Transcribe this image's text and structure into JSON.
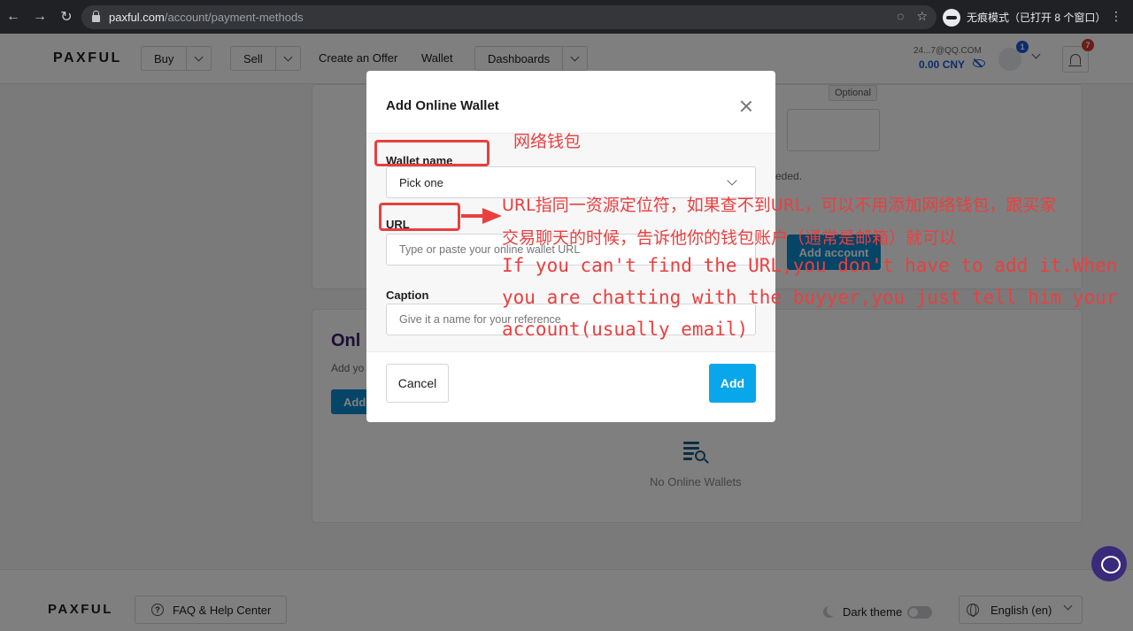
{
  "browser": {
    "url_host": "paxful.com",
    "url_path": "/account/payment-methods",
    "incognito_label": "无痕模式（已打开 8 个窗口）"
  },
  "header": {
    "logo": "PAXFUL",
    "nav": {
      "buy": "Buy",
      "sell": "Sell",
      "create_offer": "Create an Offer",
      "wallet": "Wallet",
      "dashboards": "Dashboards"
    },
    "account_email": "24...7@QQ.COM",
    "balance": "0.00 CNY",
    "notifications_badge": "1",
    "bell_badge": "7"
  },
  "background": {
    "optional_tag": "Optional",
    "needed_text": "eded.",
    "add_account_button": "Add account",
    "online_wallets_heading": "Onl",
    "add_your_text": "Add yo",
    "add_button": "Add",
    "empty_state": "No Online Wallets"
  },
  "modal": {
    "title": "Add Online Wallet",
    "wallet_name_label": "Wallet name",
    "wallet_name_value": "Pick one",
    "url_label": "URL",
    "url_placeholder": "Type or paste your online wallet URL",
    "caption_label": "Caption",
    "caption_placeholder": "Give it a name for your reference",
    "cancel": "Cancel",
    "add": "Add"
  },
  "annotations": {
    "wallet_cn": "网络钱包",
    "url_cn_line1": "URL指同一资源定位符，如果查不到URL，可以不用添加网络钱包，跟买家",
    "url_cn_line2": "交易聊天的时候，告诉他你的钱包账户（通常是邮箱）就可以",
    "en_line1": "If you can't find the URL,you don't have to add it.When",
    "en_line2": "you are chatting with the buyyer,you just tell him your",
    "en_line3": "account(usually email)"
  },
  "footer": {
    "logo": "PAXFUL",
    "faq": "FAQ & Help Center",
    "dark_theme": "Dark theme",
    "language": "English (en)"
  },
  "colors": {
    "accent_blue": "#08a6ea",
    "annotation_red": "#e8403f",
    "brand_purple": "#3d1b6b"
  }
}
